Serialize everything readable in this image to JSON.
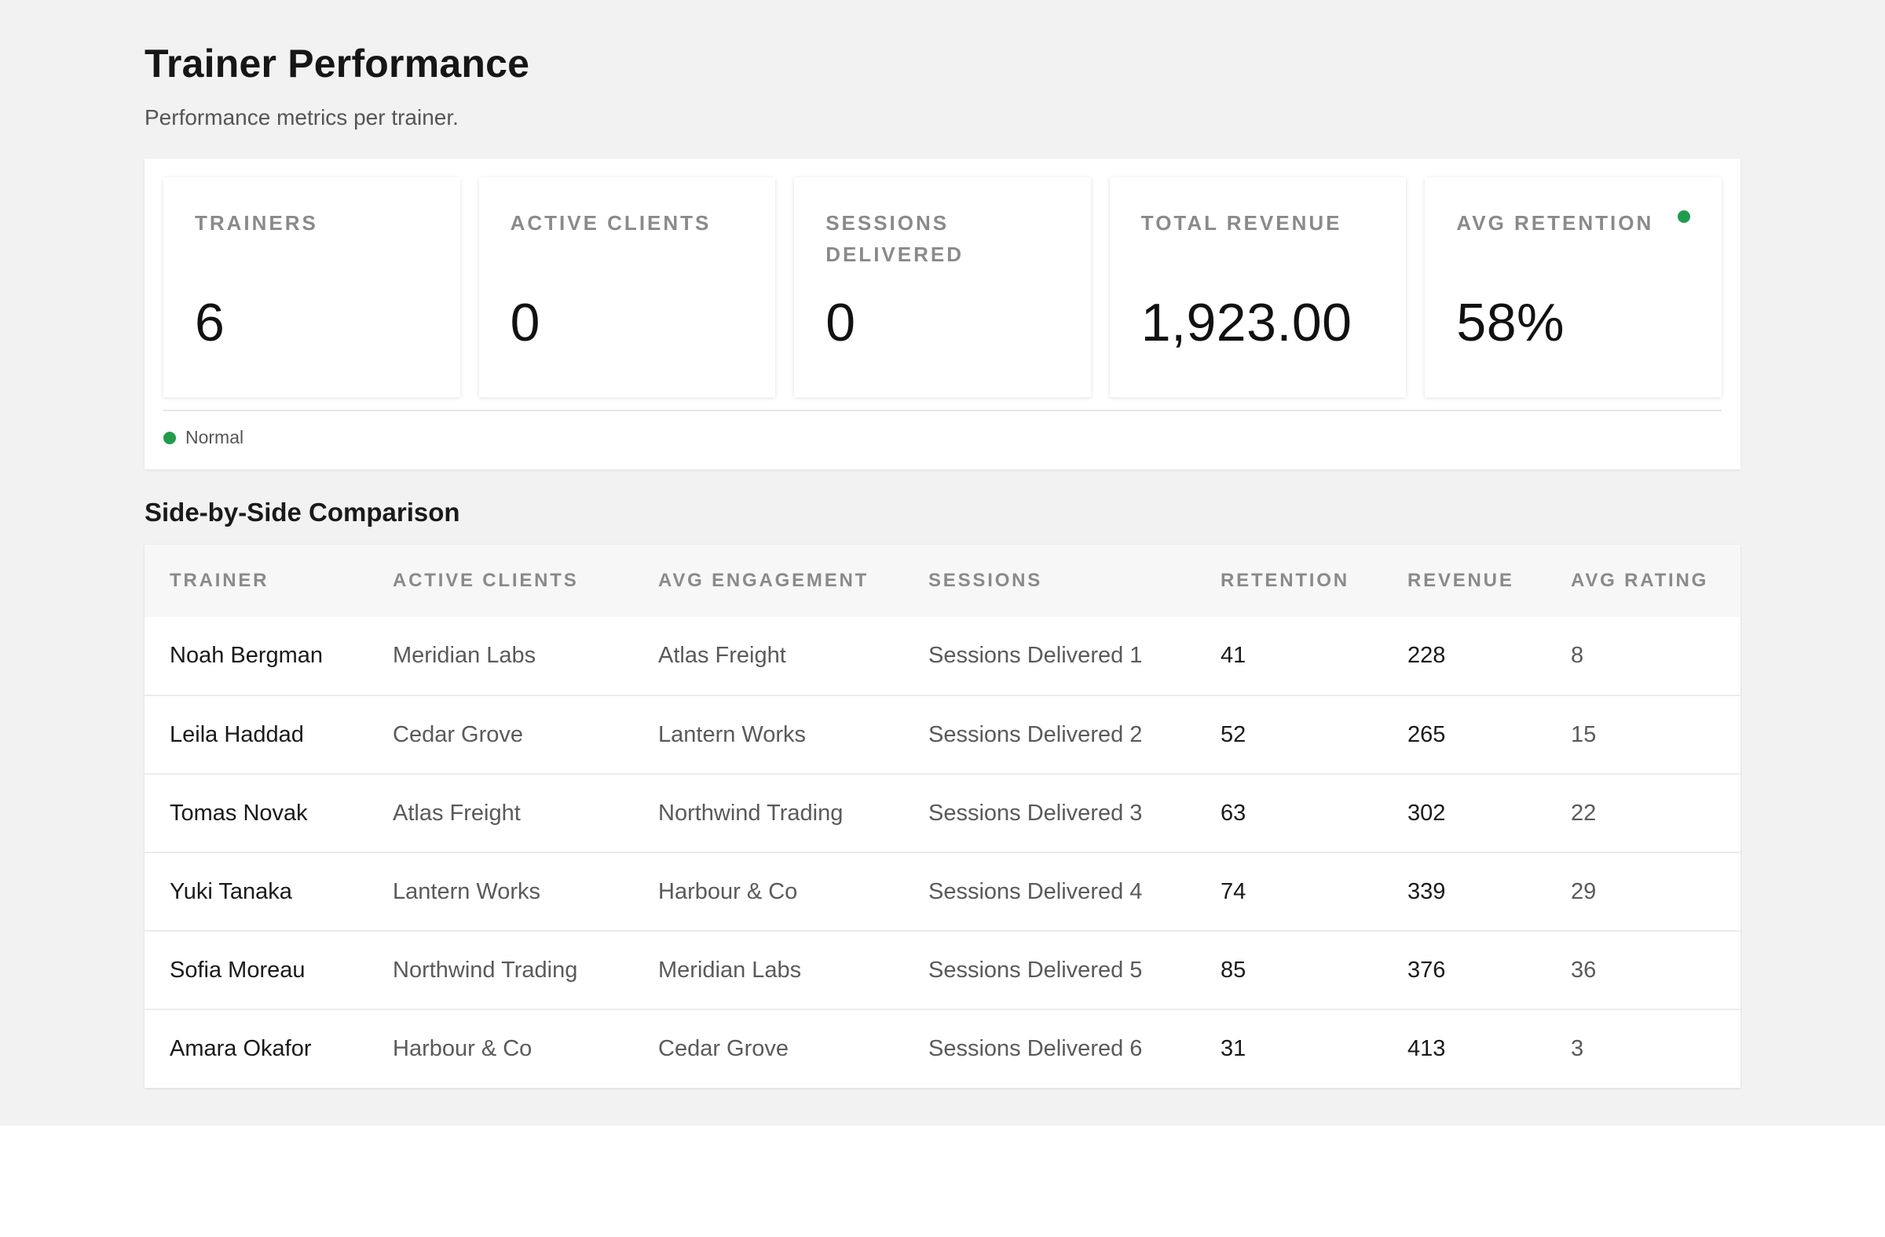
{
  "page": {
    "title": "Trainer Performance",
    "subtitle": "Performance metrics per trainer."
  },
  "kpis": [
    {
      "label": "TRAINERS",
      "value": "6",
      "indicator": false
    },
    {
      "label": "ACTIVE CLIENTS",
      "value": "0",
      "indicator": false
    },
    {
      "label": "SESSIONS DELIVERED",
      "value": "0",
      "indicator": false
    },
    {
      "label": "TOTAL REVENUE",
      "value": "1,923.00",
      "indicator": false
    },
    {
      "label": "AVG RETENTION",
      "value": "58%",
      "indicator": true
    }
  ],
  "legend": {
    "label": "Normal",
    "color": "#1f9d4c"
  },
  "comparison": {
    "title": "Side-by-Side Comparison",
    "columns": [
      "TRAINER",
      "ACTIVE CLIENTS",
      "AVG ENGAGEMENT",
      "SESSIONS",
      "RETENTION",
      "REVENUE",
      "AVG RATING"
    ],
    "rows": [
      [
        "Noah Bergman",
        "Meridian Labs",
        "Atlas Freight",
        "Sessions Delivered 1",
        "41",
        "228",
        "8"
      ],
      [
        "Leila Haddad",
        "Cedar Grove",
        "Lantern Works",
        "Sessions Delivered 2",
        "52",
        "265",
        "15"
      ],
      [
        "Tomas Novak",
        "Atlas Freight",
        "Northwind Trading",
        "Sessions Delivered 3",
        "63",
        "302",
        "22"
      ],
      [
        "Yuki Tanaka",
        "Lantern Works",
        "Harbour & Co",
        "Sessions Delivered 4",
        "74",
        "339",
        "29"
      ],
      [
        "Sofia Moreau",
        "Northwind Trading",
        "Meridian Labs",
        "Sessions Delivered 5",
        "85",
        "376",
        "36"
      ],
      [
        "Amara Okafor",
        "Harbour & Co",
        "Cedar Grove",
        "Sessions Delivered 6",
        "31",
        "413",
        "3"
      ]
    ]
  }
}
